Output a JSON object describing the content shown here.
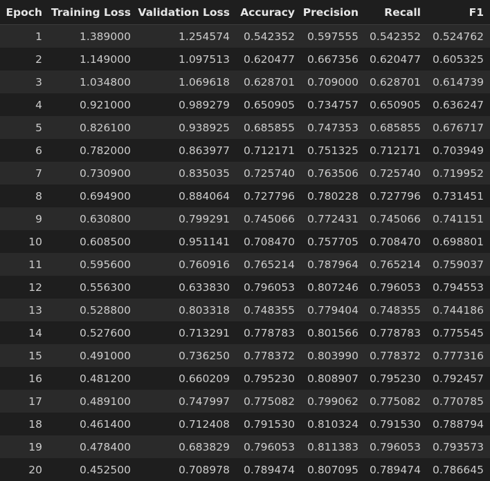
{
  "table": {
    "headers": [
      "Epoch",
      "Training Loss",
      "Validation Loss",
      "Accuracy",
      "Precision",
      "Recall",
      "F1"
    ],
    "rows": [
      [
        "1",
        "1.389000",
        "1.254574",
        "0.542352",
        "0.597555",
        "0.542352",
        "0.524762"
      ],
      [
        "2",
        "1.149000",
        "1.097513",
        "0.620477",
        "0.667356",
        "0.620477",
        "0.605325"
      ],
      [
        "3",
        "1.034800",
        "1.069618",
        "0.628701",
        "0.709000",
        "0.628701",
        "0.614739"
      ],
      [
        "4",
        "0.921000",
        "0.989279",
        "0.650905",
        "0.734757",
        "0.650905",
        "0.636247"
      ],
      [
        "5",
        "0.826100",
        "0.938925",
        "0.685855",
        "0.747353",
        "0.685855",
        "0.676717"
      ],
      [
        "6",
        "0.782000",
        "0.863977",
        "0.712171",
        "0.751325",
        "0.712171",
        "0.703949"
      ],
      [
        "7",
        "0.730900",
        "0.835035",
        "0.725740",
        "0.763506",
        "0.725740",
        "0.719952"
      ],
      [
        "8",
        "0.694900",
        "0.884064",
        "0.727796",
        "0.780228",
        "0.727796",
        "0.731451"
      ],
      [
        "9",
        "0.630800",
        "0.799291",
        "0.745066",
        "0.772431",
        "0.745066",
        "0.741151"
      ],
      [
        "10",
        "0.608500",
        "0.951141",
        "0.708470",
        "0.757705",
        "0.708470",
        "0.698801"
      ],
      [
        "11",
        "0.595600",
        "0.760916",
        "0.765214",
        "0.787964",
        "0.765214",
        "0.759037"
      ],
      [
        "12",
        "0.556300",
        "0.633830",
        "0.796053",
        "0.807246",
        "0.796053",
        "0.794553"
      ],
      [
        "13",
        "0.528800",
        "0.803318",
        "0.748355",
        "0.779404",
        "0.748355",
        "0.744186"
      ],
      [
        "14",
        "0.527600",
        "0.713291",
        "0.778783",
        "0.801566",
        "0.778783",
        "0.775545"
      ],
      [
        "15",
        "0.491000",
        "0.736250",
        "0.778372",
        "0.803990",
        "0.778372",
        "0.777316"
      ],
      [
        "16",
        "0.481200",
        "0.660209",
        "0.795230",
        "0.808907",
        "0.795230",
        "0.792457"
      ],
      [
        "17",
        "0.489100",
        "0.747997",
        "0.775082",
        "0.799062",
        "0.775082",
        "0.770785"
      ],
      [
        "18",
        "0.461400",
        "0.712408",
        "0.791530",
        "0.810324",
        "0.791530",
        "0.788794"
      ],
      [
        "19",
        "0.478400",
        "0.683829",
        "0.796053",
        "0.811383",
        "0.796053",
        "0.793573"
      ],
      [
        "20",
        "0.452500",
        "0.708978",
        "0.789474",
        "0.807095",
        "0.789474",
        "0.786645"
      ]
    ]
  }
}
